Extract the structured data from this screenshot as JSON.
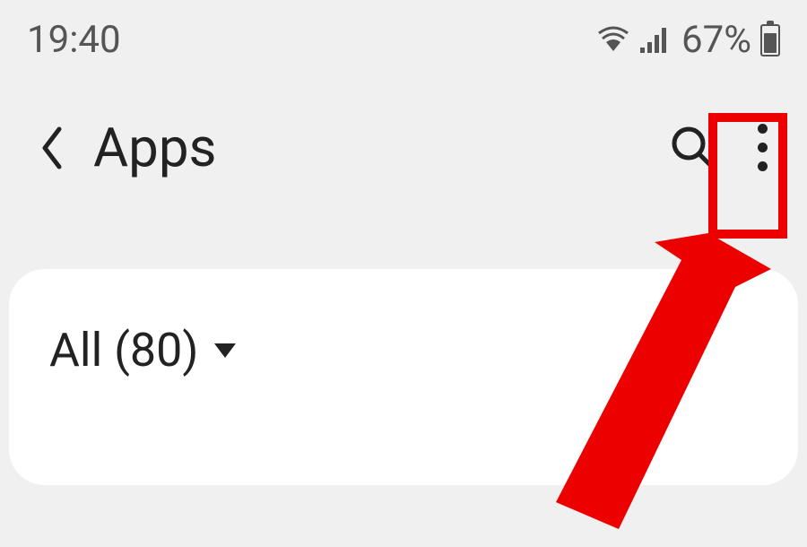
{
  "status_bar": {
    "time": "19:40",
    "battery_percent": "67%"
  },
  "header": {
    "title": "Apps"
  },
  "filter": {
    "label": "All (80)"
  }
}
